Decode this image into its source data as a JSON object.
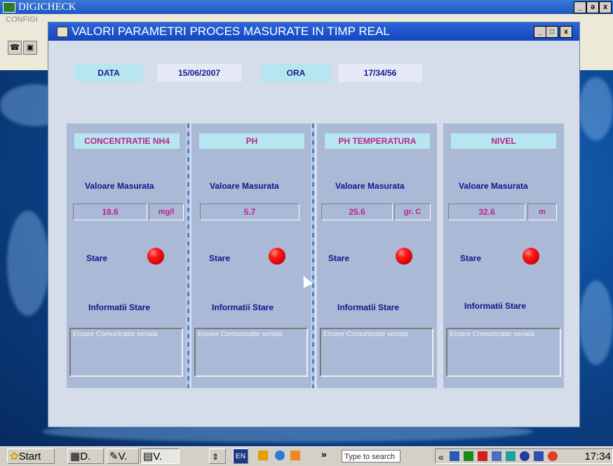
{
  "bg_app": {
    "title": "DIGICHECK",
    "menu": "CONFIGI",
    "controls": [
      "_",
      "ə",
      "x"
    ]
  },
  "window": {
    "title": "VALORI PARAMETRI PROCES MASURATE IN  TIMP REAL",
    "buttons": [
      "_",
      "□",
      "x"
    ]
  },
  "header": {
    "date_label": "DATA",
    "date_value": "15/06/2007",
    "time_label": "ORA",
    "time_value": "17/34/56"
  },
  "panels": [
    {
      "name": "CONCENTRATIE NH4",
      "measured_label": "Valoare Masurata",
      "value": "18.6",
      "unit": "mg/l",
      "state_label": "Stare",
      "state_color": "#e00000",
      "info_label": "Informatii Stare",
      "info_text": "Eroare Comunicatie seriala"
    },
    {
      "name": "PH",
      "measured_label": "Valoare Masurata",
      "value": "5.7",
      "unit": "",
      "state_label": "Stare",
      "state_color": "#e00000",
      "info_label": "Informatii Stare",
      "info_text": "Eroare Comunicatie seriala"
    },
    {
      "name": "PH TEMPERATURA",
      "measured_label": "Valoare Masurata",
      "value": "25.6",
      "unit": "gr. C",
      "state_label": "Stare",
      "state_color": "#e00000",
      "info_label": "Informatii Stare",
      "info_text": "Eroare Comunicatie seriala"
    },
    {
      "name": "NIVEL",
      "measured_label": "Valoare Masurata",
      "value": "32.6",
      "unit": "m",
      "state_label": "Stare",
      "state_color": "#e00000",
      "info_label": "Informatii Stare",
      "info_text": "Eroare Comunicatie seriala"
    }
  ],
  "taskbar": {
    "start_label": "Start",
    "tasks": [
      "D.",
      "V.",
      "V."
    ],
    "lang": "EN",
    "more": "»",
    "search_placeholder": "Type to search",
    "tray_more": "«",
    "clock": "17:34"
  }
}
